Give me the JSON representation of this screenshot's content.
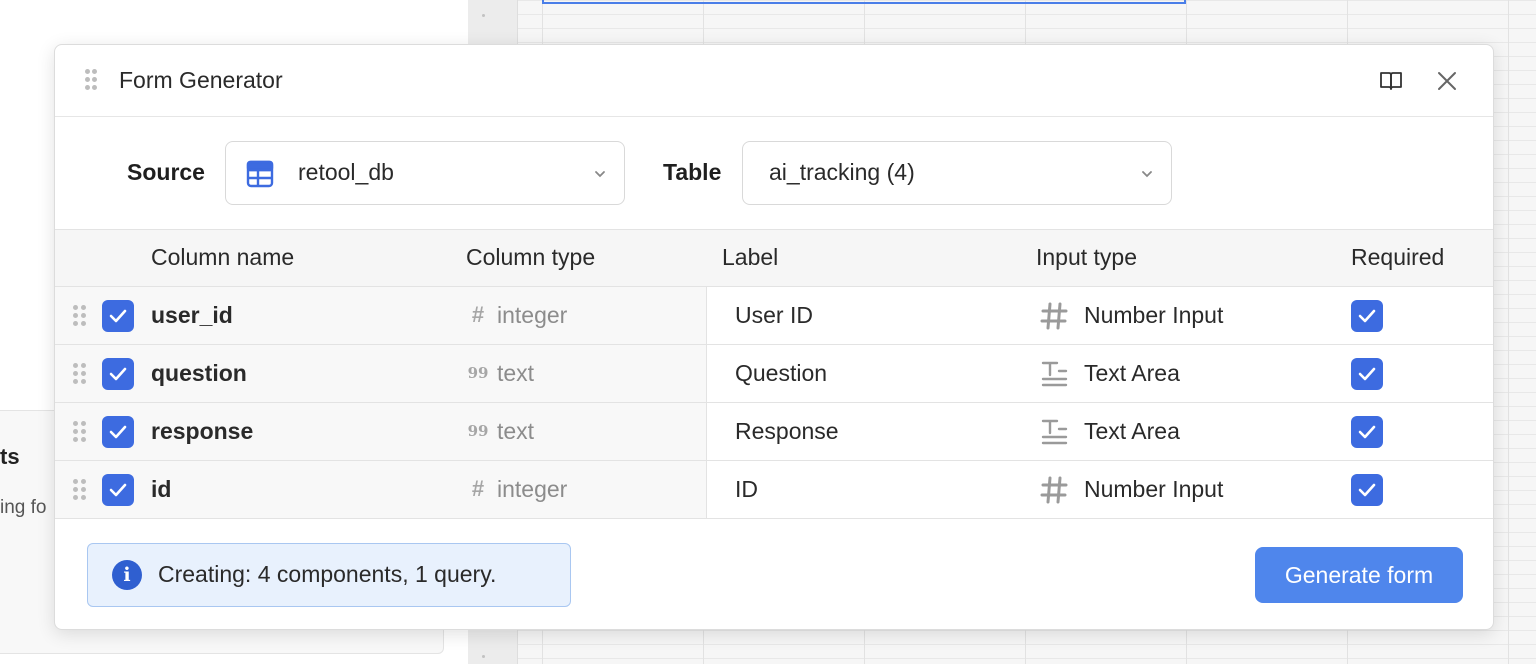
{
  "background": {
    "panel_title": "ts",
    "panel_subtitle": "ing fo"
  },
  "modal": {
    "title": "Form Generator",
    "icons": {
      "drag": "drag-handle-icon",
      "docs": "book-icon",
      "close": "close-icon"
    },
    "source": {
      "label": "Source",
      "value": "retool_db",
      "icon": "table-grid-icon"
    },
    "table": {
      "label": "Table",
      "value": "ai_tracking (4)"
    },
    "columns": {
      "column_name": "Column name",
      "column_type": "Column type",
      "label": "Label",
      "input_type": "Input type",
      "required": "Required"
    },
    "rows": [
      {
        "column_name": "user_id",
        "type_icon": "#",
        "column_type": "integer",
        "label": "User ID",
        "input_type": "Number Input",
        "input_icon": "hash-icon",
        "selected": true,
        "required": true
      },
      {
        "column_name": "question",
        "type_icon": "99",
        "column_type": "text",
        "label": "Question",
        "input_type": "Text Area",
        "input_icon": "text-area-icon",
        "selected": true,
        "required": true
      },
      {
        "column_name": "response",
        "type_icon": "99",
        "column_type": "text",
        "label": "Response",
        "input_type": "Text Area",
        "input_icon": "text-area-icon",
        "selected": true,
        "required": true
      },
      {
        "column_name": "id",
        "type_icon": "#",
        "column_type": "integer",
        "label": "ID",
        "input_type": "Number Input",
        "input_icon": "hash-icon",
        "selected": true,
        "required": true
      }
    ],
    "info": {
      "icon": "info-icon",
      "text": "Creating: 4 components, 1 query."
    },
    "generate_label": "Generate form"
  },
  "colors": {
    "accent": "#3d6be0",
    "button": "#4f86ec",
    "info_bg": "#e8f1fd",
    "info_border": "#a9c7f1"
  }
}
